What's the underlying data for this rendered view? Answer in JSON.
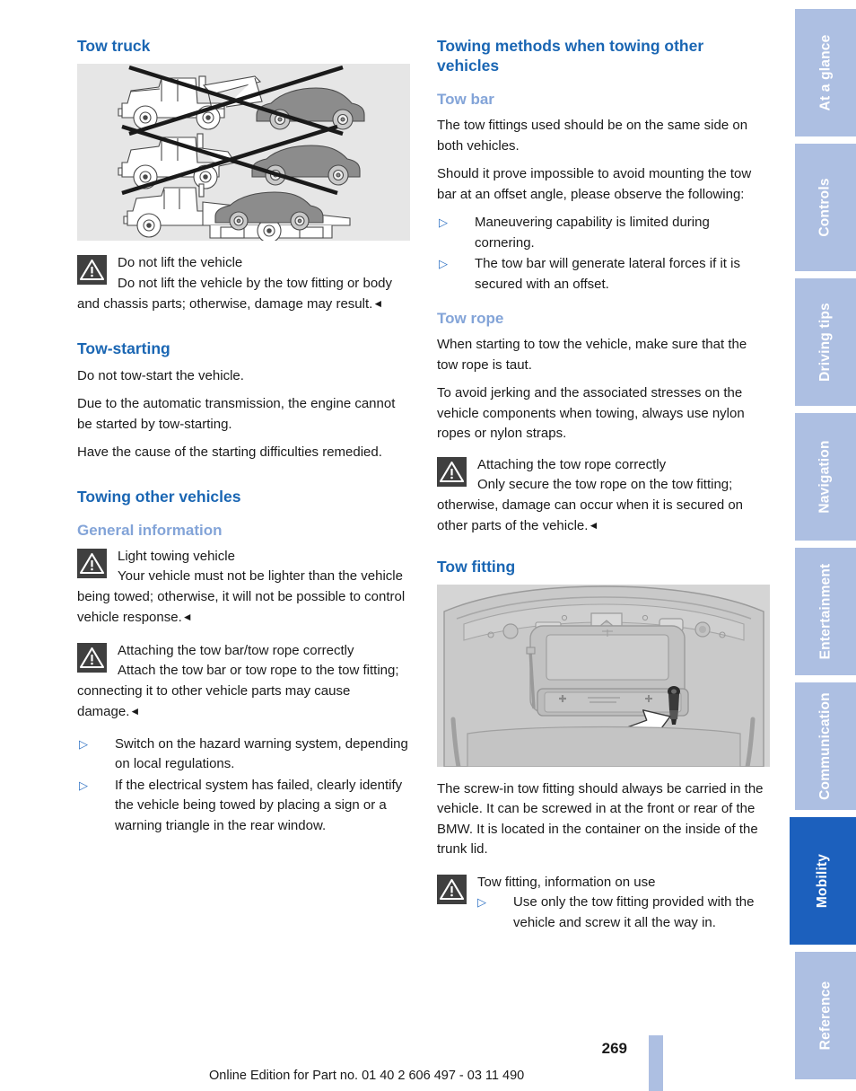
{
  "document": {
    "page_number": "269",
    "edition_note": "Online Edition for Part no. 01 40 2 606 497 - 03 11 490"
  },
  "colors": {
    "heading_main": "#1a66b3",
    "heading_sub": "#83a4d8",
    "bullet": "#2f72c4",
    "tab_inactive": "#adbfe2",
    "tab_active": "#1c60bd",
    "warning_icon_bg": "#3f3f3f",
    "figure_bg": "#e6e6e6"
  },
  "left_column": {
    "tow_truck": {
      "heading": "Tow truck",
      "figure_caption": "tow-truck-methods-illustration",
      "warning": {
        "title": "Do not lift the vehicle",
        "body": "Do not lift the vehicle by the tow fitting or body and chassis parts; otherwise, damage may result.",
        "end_mark": "◄"
      }
    },
    "tow_starting": {
      "heading": "Tow-starting",
      "paragraphs": [
        "Do not tow-start the vehicle.",
        "Due to the automatic transmission, the engine cannot be started by tow-starting.",
        "Have the cause of the starting difficulties remedied."
      ]
    },
    "towing_other_vehicles": {
      "heading": "Towing other vehicles",
      "general_information": {
        "heading": "General information",
        "warnings": [
          {
            "title": "Light towing vehicle",
            "body": "Your vehicle must not be lighter than the vehicle being towed; otherwise, it will not be possible to control vehicle response.",
            "end_mark": "◄"
          },
          {
            "title": "Attaching the tow bar/tow rope correctly",
            "body": "Attach the tow bar or tow rope to the tow fitting; connecting it to other vehicle parts may cause damage.",
            "end_mark": "◄"
          }
        ],
        "bullets": [
          "Switch on the hazard warning system, depending on local regulations.",
          "If the electrical system has failed, clearly identify the vehicle being towed by placing a sign or a warning triangle in the rear window."
        ]
      }
    }
  },
  "right_column": {
    "towing_methods": {
      "heading": "Towing methods when towing other vehicles"
    },
    "tow_bar": {
      "heading": "Tow bar",
      "paragraphs": [
        "The tow fittings used should be on the same side on both vehicles.",
        "Should it prove impossible to avoid mounting the tow bar at an offset angle, please observe the following:"
      ],
      "bullets": [
        "Maneuvering capability is limited during cornering.",
        "The tow bar will generate lateral forces if it is secured with an offset."
      ]
    },
    "tow_rope": {
      "heading": "Tow rope",
      "paragraphs": [
        "When starting to tow the vehicle, make sure that the tow rope is taut.",
        "To avoid jerking and the associated stresses on the vehicle components when towing, always use nylon ropes or nylon straps."
      ],
      "warning": {
        "title": "Attaching the tow rope correctly",
        "body": "Only secure the tow rope on the tow fitting; otherwise, damage can occur when it is secured on other parts of the vehicle.",
        "end_mark": "◄"
      }
    },
    "tow_fitting": {
      "heading": "Tow fitting",
      "figure_caption": "trunk-lid-tow-fitting-illustration",
      "paragraph": "The screw-in tow fitting should always be carried in the vehicle. It can be screwed in at the front or rear of the BMW. It is located in the container on the inside of the trunk lid.",
      "warning": {
        "title": "Tow fitting, information on use",
        "bullets": [
          "Use only the tow fitting provided with the vehicle and screw it all the way in."
        ]
      }
    }
  },
  "sidebar": {
    "tabs": [
      {
        "label": "At a glance",
        "active": false
      },
      {
        "label": "Controls",
        "active": false
      },
      {
        "label": "Driving tips",
        "active": false
      },
      {
        "label": "Navigation",
        "active": false
      },
      {
        "label": "Entertainment",
        "active": false
      },
      {
        "label": "Communication",
        "active": false
      },
      {
        "label": "Mobility",
        "active": true
      },
      {
        "label": "Reference",
        "active": false
      }
    ]
  },
  "icons": {
    "warning": "warning-triangle-icon",
    "bullet": "triangle-right-bullet-icon"
  }
}
